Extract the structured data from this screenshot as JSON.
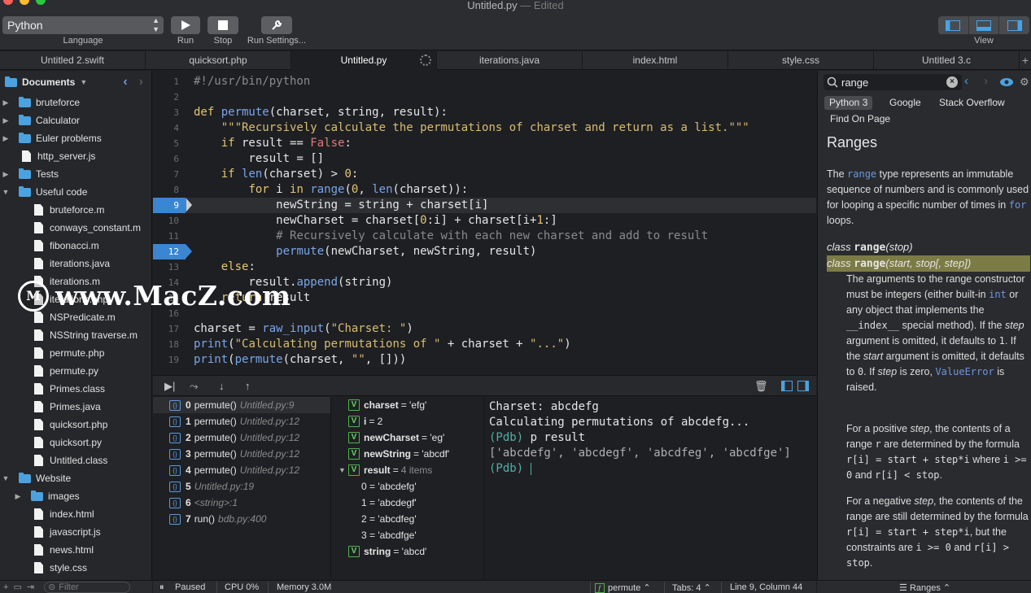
{
  "window": {
    "title": "Untitled.py",
    "edited": "— Edited"
  },
  "toolbar": {
    "language_value": "Python",
    "language_label": "Language",
    "run_label": "Run",
    "stop_label": "Stop",
    "run_settings_label": "Run Settings...",
    "view_label": "View"
  },
  "tabs": [
    "Untitled 2.swift",
    "quicksort.php",
    "Untitled.py",
    "iterations.java",
    "index.html",
    "style.css",
    "Untitled 3.c"
  ],
  "sidebar": {
    "root": "Documents",
    "items": [
      {
        "label": "bruteforce",
        "type": "folder",
        "disc": "▶",
        "depth": 0
      },
      {
        "label": "Calculator",
        "type": "folder",
        "disc": "▶",
        "depth": 0
      },
      {
        "label": "Euler problems",
        "type": "folder",
        "disc": "▶",
        "depth": 0
      },
      {
        "label": "http_server.js",
        "type": "file",
        "disc": "",
        "depth": 0
      },
      {
        "label": "Tests",
        "type": "folder",
        "disc": "▶",
        "depth": 0
      },
      {
        "label": "Useful code",
        "type": "folder",
        "disc": "▼",
        "depth": 0
      },
      {
        "label": "bruteforce.m",
        "type": "file",
        "disc": "",
        "depth": 1
      },
      {
        "label": "conways_constant.m",
        "type": "file",
        "disc": "",
        "depth": 1
      },
      {
        "label": "fibonacci.m",
        "type": "file",
        "disc": "",
        "depth": 1
      },
      {
        "label": "iterations.java",
        "type": "file",
        "disc": "",
        "depth": 1
      },
      {
        "label": "iterations.m",
        "type": "file",
        "disc": "",
        "depth": 1
      },
      {
        "label": "iterations.php",
        "type": "file",
        "disc": "",
        "depth": 1
      },
      {
        "label": "NSPredicate.m",
        "type": "file",
        "disc": "",
        "depth": 1
      },
      {
        "label": "NSString traverse.m",
        "type": "file",
        "disc": "",
        "depth": 1
      },
      {
        "label": "permute.php",
        "type": "file",
        "disc": "",
        "depth": 1
      },
      {
        "label": "permute.py",
        "type": "file",
        "disc": "",
        "depth": 1
      },
      {
        "label": "Primes.class",
        "type": "file",
        "disc": "",
        "depth": 1
      },
      {
        "label": "Primes.java",
        "type": "file",
        "disc": "",
        "depth": 1
      },
      {
        "label": "quicksort.php",
        "type": "file",
        "disc": "",
        "depth": 1
      },
      {
        "label": "quicksort.py",
        "type": "file",
        "disc": "",
        "depth": 1
      },
      {
        "label": "Untitled.class",
        "type": "file",
        "disc": "",
        "depth": 1
      },
      {
        "label": "Website",
        "type": "folder",
        "disc": "▼",
        "depth": 0
      },
      {
        "label": "images",
        "type": "folder",
        "disc": "▶",
        "depth": 1
      },
      {
        "label": "index.html",
        "type": "file",
        "disc": "",
        "depth": 1
      },
      {
        "label": "javascript.js",
        "type": "file",
        "disc": "",
        "depth": 1
      },
      {
        "label": "news.html",
        "type": "file",
        "disc": "",
        "depth": 1
      },
      {
        "label": "style.css",
        "type": "file",
        "disc": "",
        "depth": 1
      }
    ],
    "filter_placeholder": "Filter"
  },
  "editor": {
    "lines": [
      {
        "n": "1",
        "parts": [
          [
            "cm",
            "#!/usr/bin/python"
          ]
        ]
      },
      {
        "n": "2",
        "parts": []
      },
      {
        "n": "3",
        "parts": [
          [
            "kw",
            "def "
          ],
          [
            "fn",
            "permute"
          ],
          [
            "",
            "(charset, string, result):"
          ]
        ]
      },
      {
        "n": "4",
        "parts": [
          [
            "",
            "    "
          ],
          [
            "str",
            "\"\"\"Recursively calculate the permutations of charset and return as a list.\"\"\""
          ]
        ]
      },
      {
        "n": "5",
        "parts": [
          [
            "",
            "    "
          ],
          [
            "kw",
            "if"
          ],
          [
            "",
            " result == "
          ],
          [
            "lit",
            "False"
          ],
          [
            "",
            ":"
          ]
        ]
      },
      {
        "n": "6",
        "parts": [
          [
            "",
            "        result = []"
          ]
        ]
      },
      {
        "n": "7",
        "parts": [
          [
            "",
            "    "
          ],
          [
            "kw",
            "if "
          ],
          [
            "bi",
            "len"
          ],
          [
            "",
            "(charset) > "
          ],
          [
            "num",
            "0"
          ],
          [
            "",
            ":"
          ]
        ]
      },
      {
        "n": "8",
        "parts": [
          [
            "",
            "        "
          ],
          [
            "kw",
            "for"
          ],
          [
            "",
            " i "
          ],
          [
            "kw",
            "in "
          ],
          [
            "bi",
            "range"
          ],
          [
            "",
            "("
          ],
          [
            "num",
            "0"
          ],
          [
            "",
            ", "
          ],
          [
            "bi",
            "len"
          ],
          [
            "",
            "(charset)):"
          ]
        ]
      },
      {
        "n": "9",
        "parts": [
          [
            "",
            "            newString = string + charset[i]"
          ]
        ]
      },
      {
        "n": "10",
        "parts": [
          [
            "",
            "            newCharset = charset["
          ],
          [
            "num",
            "0"
          ],
          [
            "",
            ":i] + charset[i+"
          ],
          [
            "num",
            "1"
          ],
          [
            "",
            ":]"
          ]
        ]
      },
      {
        "n": "11",
        "parts": [
          [
            "",
            "            "
          ],
          [
            "cm",
            "# Recursively calculate with each new charset and add to result"
          ]
        ]
      },
      {
        "n": "12",
        "parts": [
          [
            "",
            "            "
          ],
          [
            "fn",
            "permute"
          ],
          [
            "",
            "(newCharset, newString, result)"
          ]
        ]
      },
      {
        "n": "13",
        "parts": [
          [
            "",
            "    "
          ],
          [
            "kw",
            "else"
          ],
          [
            "",
            ":"
          ]
        ]
      },
      {
        "n": "14",
        "parts": [
          [
            "",
            "        result."
          ],
          [
            "bi",
            "append"
          ],
          [
            "",
            "(string)"
          ]
        ]
      },
      {
        "n": "15",
        "parts": [
          [
            "",
            "    "
          ],
          [
            "kw",
            "return"
          ],
          [
            "",
            " result"
          ]
        ]
      },
      {
        "n": "16",
        "parts": []
      },
      {
        "n": "17",
        "parts": [
          [
            "",
            "charset = "
          ],
          [
            "bi",
            "raw_input"
          ],
          [
            "",
            "("
          ],
          [
            "str",
            "\"Charset: \""
          ],
          [
            "",
            ")"
          ]
        ]
      },
      {
        "n": "18",
        "parts": [
          [
            "bi",
            "print"
          ],
          [
            "",
            "("
          ],
          [
            "str",
            "\"Calculating permutations of \""
          ],
          [
            "",
            " + charset + "
          ],
          [
            "str",
            "\"...\""
          ],
          [
            "",
            ")"
          ]
        ]
      },
      {
        "n": "19",
        "parts": [
          [
            "bi",
            "print"
          ],
          [
            "",
            "("
          ],
          [
            "fn",
            "permute"
          ],
          [
            "",
            "(charset, "
          ],
          [
            "str",
            "\"\""
          ],
          [
            "",
            ", []))"
          ]
        ]
      }
    ],
    "breakpoints": [
      "9",
      "12"
    ],
    "current_line": "9"
  },
  "stack": [
    {
      "index": "0",
      "name": "permute()",
      "loc": "Untitled.py:9"
    },
    {
      "index": "1",
      "name": "permute()",
      "loc": "Untitled.py:12"
    },
    {
      "index": "2",
      "name": "permute()",
      "loc": "Untitled.py:12"
    },
    {
      "index": "3",
      "name": "permute()",
      "loc": "Untitled.py:12"
    },
    {
      "index": "4",
      "name": "permute()",
      "loc": "Untitled.py:12"
    },
    {
      "index": "5",
      "name": "",
      "loc": "Untitled.py:19"
    },
    {
      "index": "6",
      "name": "",
      "loc": "<string>:1"
    },
    {
      "index": "7",
      "name": "run()",
      "loc": "bdb.py:400"
    }
  ],
  "variables": [
    {
      "name": "charset",
      "value": "= 'efg'",
      "badge": "V",
      "indent": 0,
      "disc": ""
    },
    {
      "name": "i",
      "value": "= 2",
      "badge": "V",
      "indent": 0,
      "disc": ""
    },
    {
      "name": "newCharset",
      "value": "= 'eg'",
      "badge": "V",
      "indent": 0,
      "disc": ""
    },
    {
      "name": "newString",
      "value": "= 'abcdf'",
      "badge": "V",
      "indent": 0,
      "disc": ""
    },
    {
      "name": "result",
      "value": "=",
      "count": "4 items",
      "badge": "V",
      "indent": 0,
      "disc": "▼"
    },
    {
      "name": "",
      "value": "0 = 'abcdefg'",
      "badge": "",
      "indent": 1,
      "disc": ""
    },
    {
      "name": "",
      "value": "1 = 'abcdegf'",
      "badge": "",
      "indent": 1,
      "disc": ""
    },
    {
      "name": "",
      "value": "2 = 'abcdfeg'",
      "badge": "",
      "indent": 1,
      "disc": ""
    },
    {
      "name": "",
      "value": "3 = 'abcdfge'",
      "badge": "",
      "indent": 1,
      "disc": ""
    },
    {
      "name": "string",
      "value": "= 'abcd'",
      "badge": "V",
      "indent": 0,
      "disc": ""
    }
  ],
  "console": [
    {
      "kind": "",
      "text": "Charset: abcdefg"
    },
    {
      "kind": "",
      "text": "Calculating permutations of abcdefg..."
    },
    {
      "kind": "pdb",
      "text": "(Pdb) ",
      "rest": "p result"
    },
    {
      "kind": "out",
      "text": "['abcdefg', 'abcdegf', 'abcdfeg', 'abcdfge']"
    },
    {
      "kind": "pdb",
      "text": "(Pdb) ",
      "rest": ""
    }
  ],
  "status": {
    "state": "Paused",
    "cpu": "CPU 0%",
    "memory": "Memory 3.0M",
    "function": "permute",
    "tabs": "Tabs: 4",
    "position": "Line 9, Column 44"
  },
  "docs": {
    "search_value": "range",
    "sources": [
      "Python 3",
      "Google",
      "Stack Overflow",
      "Find On Page"
    ],
    "heading": "Ranges",
    "intro_pre": "The ",
    "intro_code": "range",
    "intro_mid": " type represents an immutable sequence of numbers and is commonly used for looping a specific number of times in ",
    "intro_code2": "for",
    "intro_post": " loops.",
    "sig1_class": "class",
    "sig1_name": "range",
    "sig1_args": "(stop)",
    "sig2_class": "class",
    "sig2_name": "range",
    "sig2_args": "(start, stop[, step])",
    "p1": "The arguments to the range constructor must be integers (either built-in",
    "p1_code": "int",
    "p1_b": "or any object that implements the",
    "p1_code2": "__index__",
    "p1_c": "special method). If the",
    "p1_step": "step",
    "p1_d": "argument is omitted, it defaults to",
    "p1_one": "1",
    "p1_e": ". If the",
    "p1_start": "start",
    "p1_f": "argument is omitted, it defaults to",
    "p1_zero": "0",
    "p1_g": ". If",
    "p1_step2": "step",
    "p1_h": "is zero,",
    "p1_err": "ValueError",
    "p1_i": "is raised.",
    "p2": "For a positive",
    "p2_step": "step",
    "p2_b": ", the contents of a range",
    "p2_r": "r",
    "p2_c": "are determined by the formula",
    "p2_f1": "r[i] = start + step*i",
    "p2_d": "where",
    "p2_f2": "i >= 0",
    "p2_e": "and",
    "p2_f3": "r[i] < stop",
    "p2_end": ".",
    "p3": "For a negative",
    "p3_step": "step",
    "p3_b": ", the contents of the range are still determined by the formula",
    "p3_f1": "r[i] = start + step*i",
    "p3_c": ", but the constraints are",
    "p3_f2": "i >= 0",
    "p3_d": "and",
    "p3_f3": "r[i] > stop",
    "p3_end": ".",
    "footer": "Ranges"
  },
  "watermark": {
    "logo": "M",
    "text": "www.MacZ.com"
  }
}
